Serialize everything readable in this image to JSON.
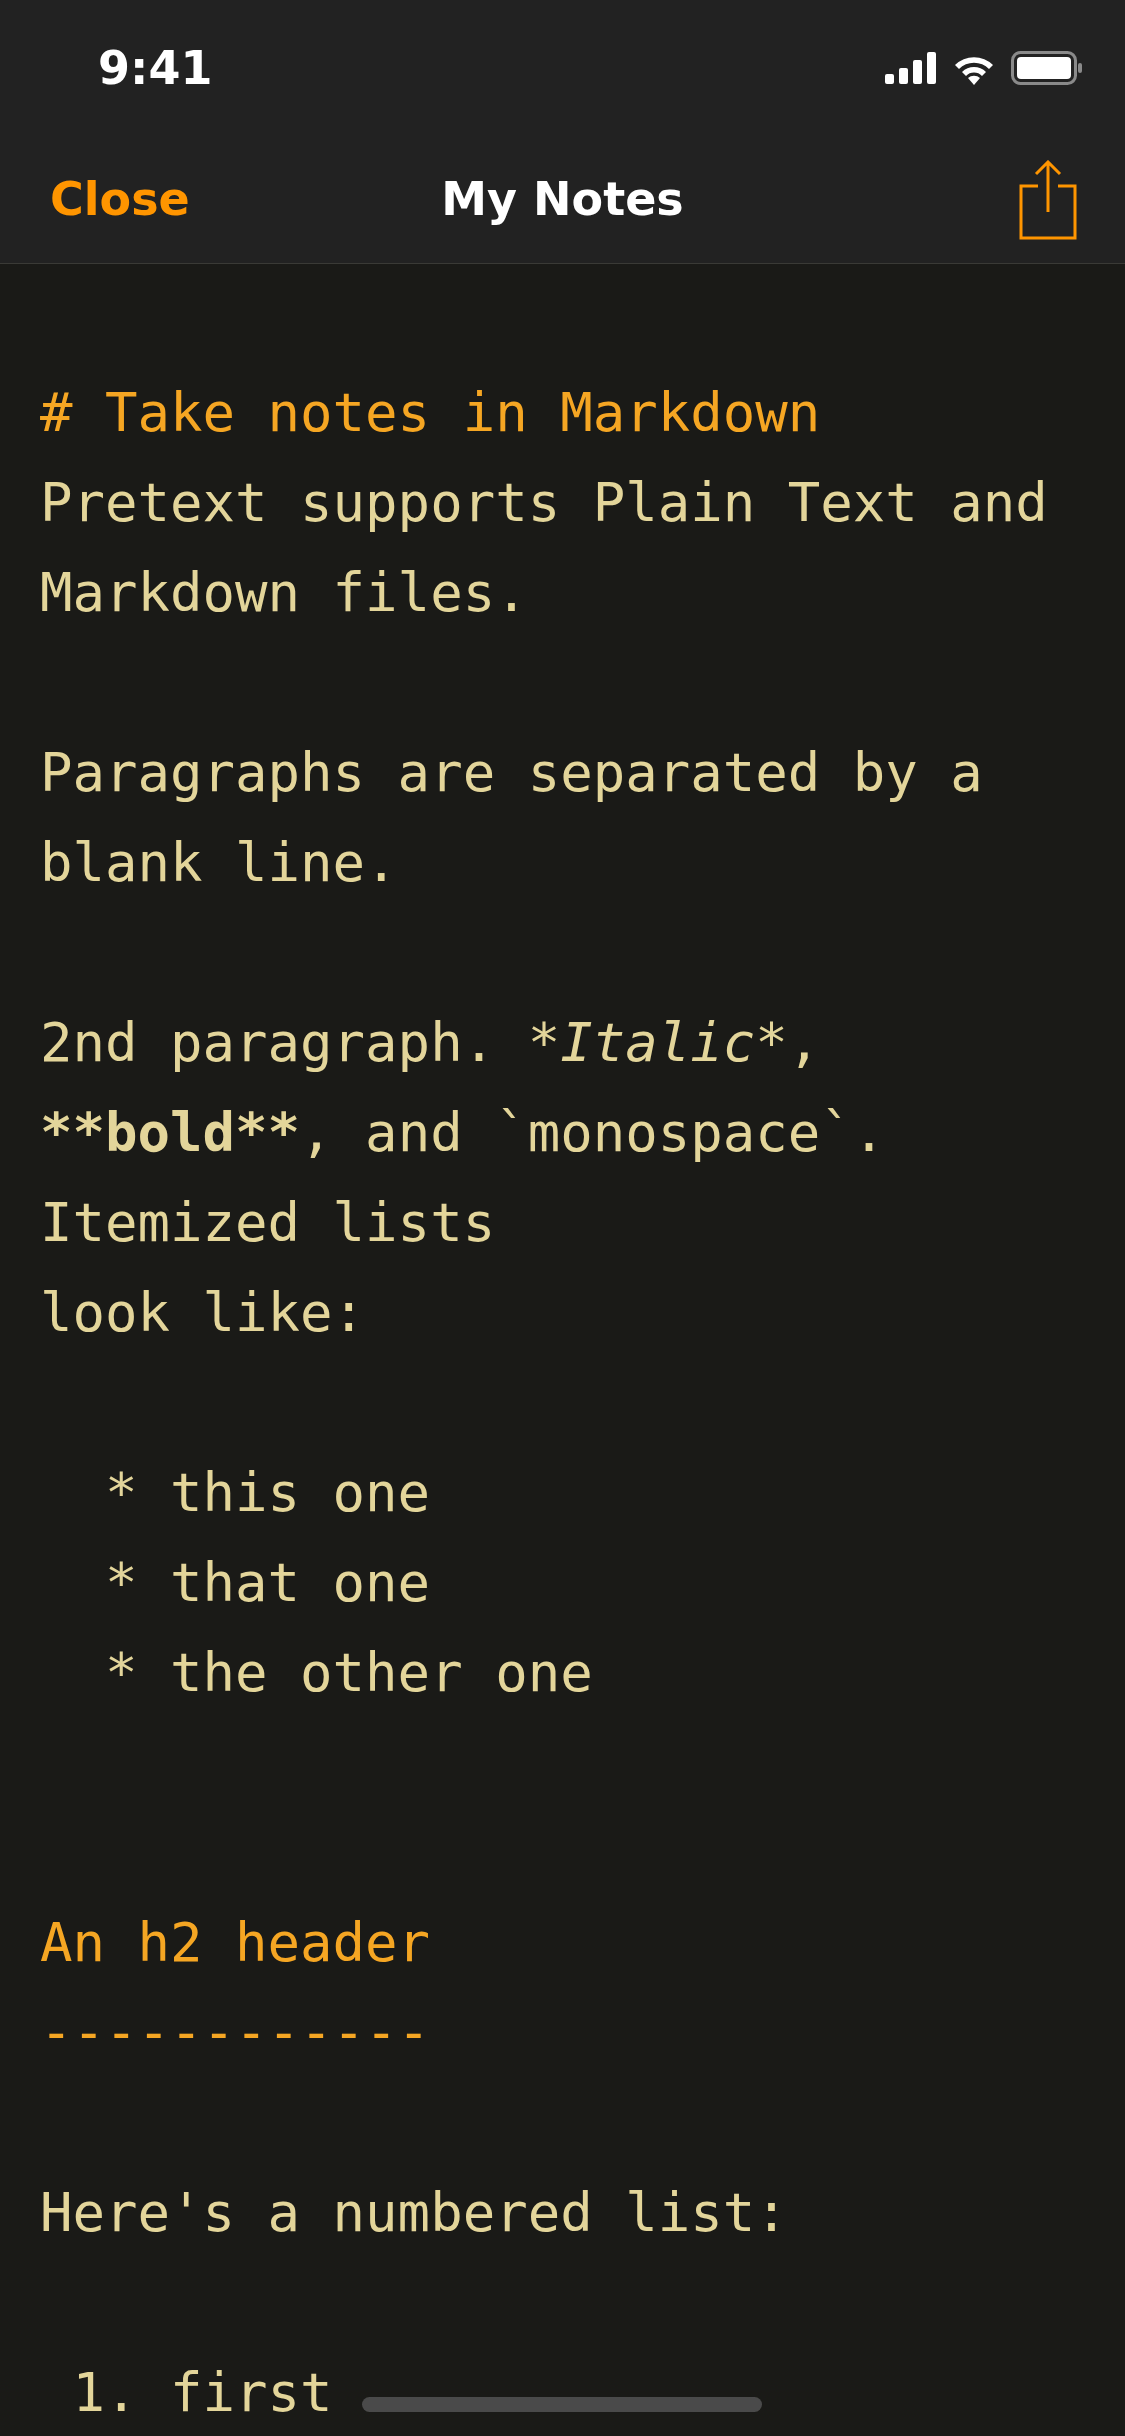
{
  "status_bar": {
    "time": "9:41"
  },
  "nav": {
    "close": "Close",
    "title": "My Notes"
  },
  "lines": [
    {
      "kind": "heading",
      "segments": [
        {
          "text": "# Take notes in Markdown",
          "kind": "plain"
        }
      ]
    },
    {
      "kind": "text",
      "segments": [
        {
          "text": "Pretext supports Plain Text and",
          "kind": "plain"
        }
      ]
    },
    {
      "kind": "text",
      "segments": [
        {
          "text": "Markdown files.",
          "kind": "plain"
        }
      ]
    },
    {
      "kind": "blank"
    },
    {
      "kind": "text",
      "segments": [
        {
          "text": "Paragraphs are separated by a",
          "kind": "plain"
        }
      ]
    },
    {
      "kind": "text",
      "segments": [
        {
          "text": "blank line.",
          "kind": "plain"
        }
      ]
    },
    {
      "kind": "blank"
    },
    {
      "kind": "text",
      "segments": [
        {
          "text": "2nd paragraph. ",
          "kind": "plain"
        },
        {
          "text": "*Italic*",
          "kind": "italic"
        },
        {
          "text": ",",
          "kind": "plain"
        }
      ]
    },
    {
      "kind": "text",
      "segments": [
        {
          "text": "**bold**",
          "kind": "bold"
        },
        {
          "text": ", and `monospace`.",
          "kind": "plain"
        }
      ]
    },
    {
      "kind": "text",
      "segments": [
        {
          "text": "Itemized lists",
          "kind": "plain"
        }
      ]
    },
    {
      "kind": "text",
      "segments": [
        {
          "text": "look like:",
          "kind": "plain"
        }
      ]
    },
    {
      "kind": "blank"
    },
    {
      "kind": "text",
      "segments": [
        {
          "text": "  * this one",
          "kind": "plain"
        }
      ]
    },
    {
      "kind": "text",
      "segments": [
        {
          "text": "  * that one",
          "kind": "plain"
        }
      ]
    },
    {
      "kind": "text",
      "segments": [
        {
          "text": "  * the other one",
          "kind": "plain"
        }
      ]
    },
    {
      "kind": "blank"
    },
    {
      "kind": "blank"
    },
    {
      "kind": "heading",
      "segments": [
        {
          "text": "An h2 header",
          "kind": "plain"
        }
      ]
    },
    {
      "kind": "heading",
      "segments": [
        {
          "text": "------------",
          "kind": "plain"
        }
      ]
    },
    {
      "kind": "blank"
    },
    {
      "kind": "text",
      "segments": [
        {
          "text": "Here's a numbered list:",
          "kind": "plain"
        }
      ]
    },
    {
      "kind": "blank"
    },
    {
      "kind": "text",
      "segments": [
        {
          "text": " 1. first",
          "kind": "plain"
        }
      ]
    }
  ]
}
